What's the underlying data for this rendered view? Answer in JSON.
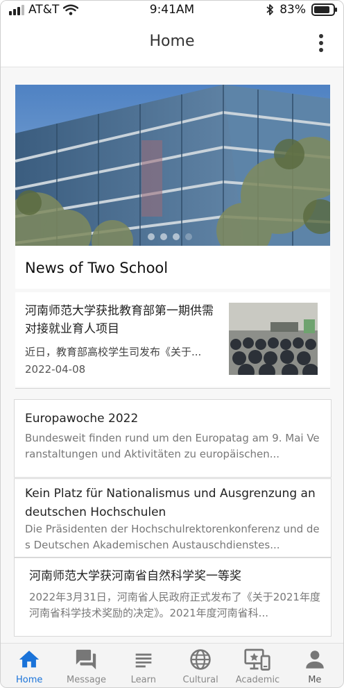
{
  "status_bar": {
    "carrier": "AT&T",
    "time": "9:41AM",
    "battery": "83%",
    "battery_level": 0.83
  },
  "app_bar": {
    "title": "Home",
    "more_icon": "more-vertical-icon"
  },
  "banner": {
    "image": "campus-building-photo",
    "slide_count": 4,
    "active_slide": 3
  },
  "section": {
    "title": "News of Two School"
  },
  "featured": {
    "title": "河南师范大学获批教育部第一期供需对接就业育人项目",
    "summary": "近日，教育部高校学生司发布《关于...",
    "date": "2022-04-08",
    "thumbnail": "conference-hall-photo"
  },
  "news": [
    {
      "title": "Europawoche 2022",
      "summary": "Bundesweit finden rund um den Europatag am 9. Mai Veranstaltungen und Aktivitäten zu europäischen..."
    },
    {
      "title": "Kein Platz für Nationalismus und Ausgrenzung an deutschen Hochschulen",
      "summary": "Die Präsidenten der Hochschulrektorenkonferenz und des Deutschen Akademischen Austauschdienstes..."
    },
    {
      "title": "河南师范大学获河南省自然科学奖一等奖",
      "summary": "2022年3月31日，河南省人民政府正式发布了《关于2021年度河南省科学技术奖励的决定》。2021年度河南省科..."
    }
  ],
  "bottom_nav": {
    "active_color": "#1a73d9",
    "inactive_color": "#888888",
    "items": [
      {
        "label": "Home",
        "icon": "home-icon",
        "active": true
      },
      {
        "label": "Message",
        "icon": "message-icon",
        "active": false
      },
      {
        "label": "Learn",
        "icon": "learn-icon",
        "active": false
      },
      {
        "label": "Cultural",
        "icon": "globe-icon",
        "active": false
      },
      {
        "label": "Academic",
        "icon": "academic-icon",
        "active": false
      },
      {
        "label": "Me",
        "icon": "person-icon",
        "active": false
      }
    ]
  }
}
